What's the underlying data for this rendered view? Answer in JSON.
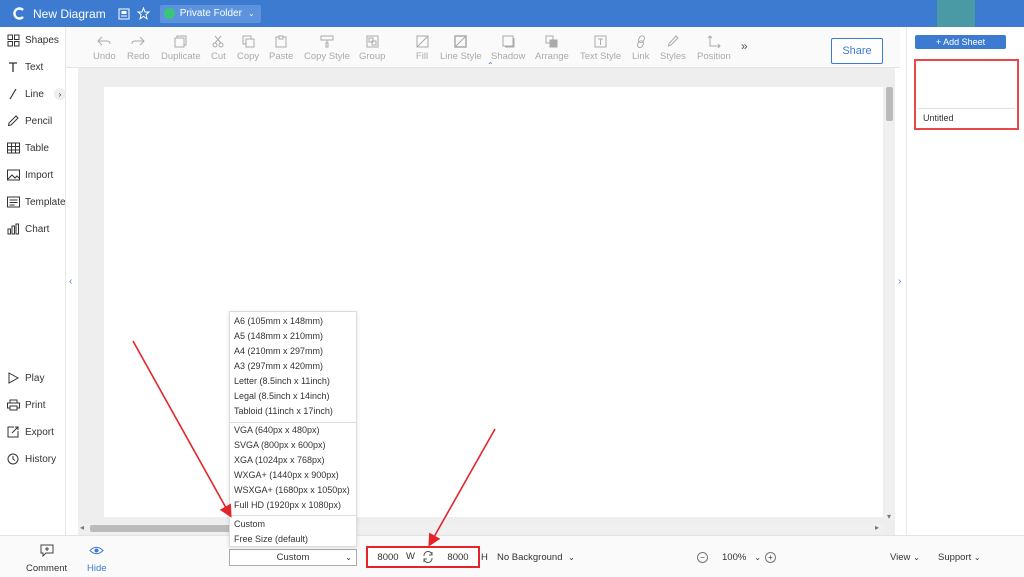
{
  "app": {
    "title": "New Diagram",
    "folder_label": "Private Folder"
  },
  "colors": {
    "titlebar": "#3d7bd1",
    "accent": "#3d7bd1",
    "annotation_red": "#e3252b"
  },
  "left_panel": {
    "items": [
      {
        "label": "Shapes",
        "icon": "shapes-icon"
      },
      {
        "label": "Text",
        "icon": "text-icon"
      },
      {
        "label": "Line",
        "icon": "line-icon"
      },
      {
        "label": "Pencil",
        "icon": "pencil-icon"
      },
      {
        "label": "Table",
        "icon": "table-icon"
      },
      {
        "label": "Import",
        "icon": "image-icon"
      },
      {
        "label": "Template",
        "icon": "template-icon"
      },
      {
        "label": "Chart",
        "icon": "chart-icon"
      },
      {
        "label": "Play",
        "icon": "play-icon"
      },
      {
        "label": "Print",
        "icon": "print-icon"
      },
      {
        "label": "Export",
        "icon": "export-icon"
      },
      {
        "label": "History",
        "icon": "history-icon"
      }
    ]
  },
  "toolbar": {
    "items": [
      {
        "label": "Undo",
        "icon": "undo-icon"
      },
      {
        "label": "Redo",
        "icon": "redo-icon"
      },
      {
        "label": "Duplicate",
        "icon": "duplicate-icon"
      },
      {
        "label": "Cut",
        "icon": "cut-icon"
      },
      {
        "label": "Copy",
        "icon": "copy-icon"
      },
      {
        "label": "Paste",
        "icon": "paste-icon"
      },
      {
        "label": "Copy Style",
        "icon": "copy-style-icon"
      },
      {
        "label": "Group",
        "icon": "group-icon"
      },
      {
        "label": "Fill",
        "icon": "fill-icon"
      },
      {
        "label": "Line Style",
        "icon": "line-style-icon"
      },
      {
        "label": "Shadow",
        "icon": "shadow-icon"
      },
      {
        "label": "Arrange",
        "icon": "arrange-icon"
      },
      {
        "label": "Text Style",
        "icon": "text-style-icon"
      },
      {
        "label": "Link",
        "icon": "link-icon"
      },
      {
        "label": "Styles",
        "icon": "styles-icon"
      },
      {
        "label": "Position",
        "icon": "position-icon"
      }
    ],
    "more": "»",
    "share_label": "Share"
  },
  "right_panel": {
    "add_sheet_label": "+ Add Sheet",
    "sheets": [
      {
        "name": "Untitled"
      }
    ]
  },
  "page_size_menu": {
    "groups": [
      [
        "A6 (105mm x 148mm)",
        "A5 (148mm x 210mm)",
        "A4 (210mm x 297mm)",
        "A3 (297mm x 420mm)",
        "Letter (8.5inch x 11inch)",
        "Legal (8.5inch x 14inch)",
        "Tabloid (11inch x 17inch)"
      ],
      [
        "VGA (640px x 480px)",
        "SVGA (800px x 600px)",
        "XGA (1024px x 768px)",
        "WXGA+ (1440px x 900px)",
        "WSXGA+ (1680px x 1050px)",
        "Full HD (1920px x 1080px)"
      ],
      [
        "Custom",
        "Free Size (default)"
      ]
    ]
  },
  "bottom_bar": {
    "comment_label": "Comment",
    "hide_label": "Hide",
    "page_size_value": "Custom",
    "width_value": "8000",
    "width_label": "W",
    "height_value": "8000",
    "height_label": "H",
    "background_label": "No Background",
    "zoom_value": "100%",
    "view_label": "View",
    "support_label": "Support"
  }
}
